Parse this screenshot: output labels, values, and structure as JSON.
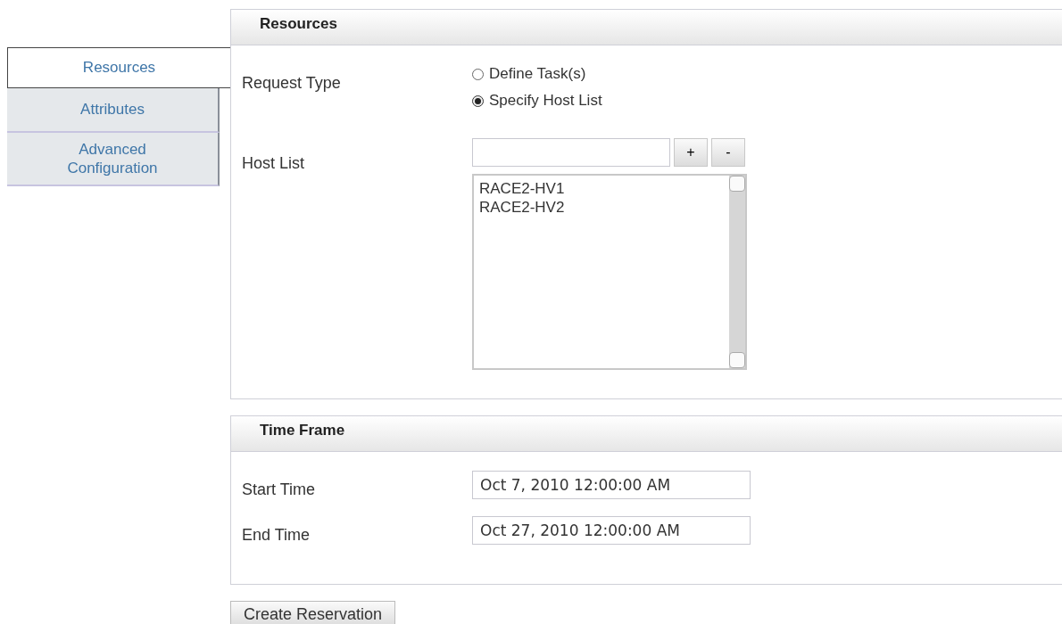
{
  "tabs": [
    {
      "label": "Resources",
      "selected": true
    },
    {
      "label": "Attributes",
      "selected": false
    },
    {
      "label": "Advanced Configuration",
      "selected": false
    }
  ],
  "resources": {
    "title": "Resources",
    "request_type": {
      "label": "Request Type",
      "options": [
        {
          "label": "Define Task(s)",
          "selected": false
        },
        {
          "label": "Specify Host List",
          "selected": true
        }
      ]
    },
    "host_list": {
      "label": "Host List",
      "add_button": "+",
      "remove_button": "-",
      "hosts": [
        "RACE2-HV1",
        "RACE2-HV2"
      ]
    }
  },
  "time_frame": {
    "title": "Time Frame",
    "fields": [
      {
        "label": "Start Time",
        "value": "Oct 7, 2010 12:00:00 AM"
      },
      {
        "label": "End Time",
        "value": "Oct 27, 2010 12:00:00 AM"
      }
    ]
  },
  "create_button": "Create Reservation"
}
